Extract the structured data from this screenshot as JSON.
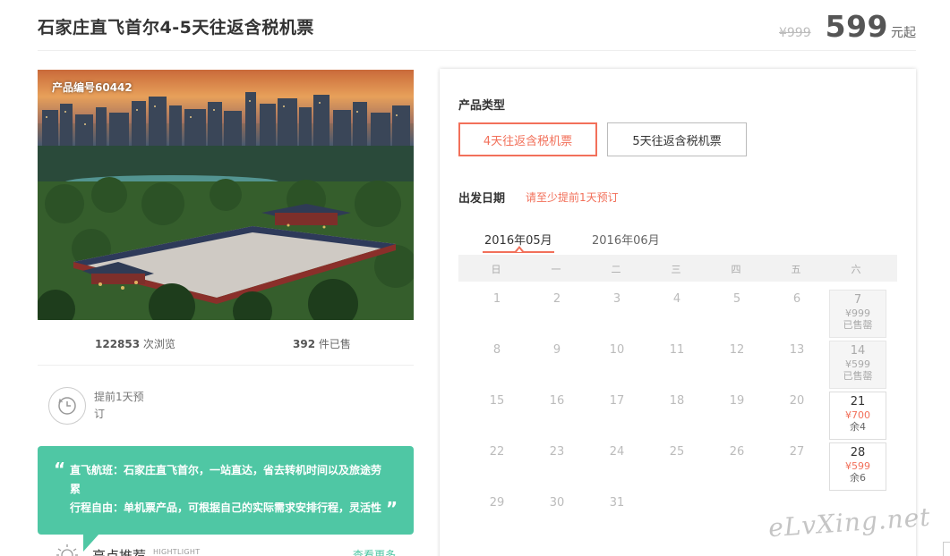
{
  "header": {
    "title": "石家庄直飞首尔4-5天往返含税机票",
    "old_price": "¥999",
    "price": "599",
    "price_unit": "元起"
  },
  "gallery": {
    "product_no": "产品编号60442"
  },
  "stats": {
    "views_num": "122853",
    "views_label": " 次浏览",
    "sold_num": "392",
    "sold_label": " 件已售"
  },
  "booking_tip": {
    "icon": "clock-icon",
    "text": "提前1天预订"
  },
  "features": {
    "line1": "直飞航班：石家庄直飞首尔，一站直达，省去转机时间以及旅途劳累",
    "line2": "行程自由：单机票产品，可根据自己的实际需求安排行程，灵活性",
    "quote_open": "“",
    "quote_close": "”"
  },
  "highlights": {
    "icon": "sun-icon",
    "title": "亮点推荐",
    "subtitle": "HIGHTLIGHT",
    "more_link": "查看更多"
  },
  "booking": {
    "type_label": "产品类型",
    "types": [
      {
        "label": "4天往返含税机票",
        "selected": true
      },
      {
        "label": "5天往返含税机票",
        "selected": false
      }
    ],
    "date_label": "出发日期",
    "date_hint": "请至少提前1天预订",
    "months": [
      "2016年05月",
      "2016年06月"
    ],
    "active_month": "2016年05月",
    "weekdays": [
      "日",
      "一",
      "二",
      "三",
      "四",
      "五",
      "六"
    ],
    "weeks": [
      [
        "1",
        "2",
        "3",
        "4",
        "5",
        "6",
        "7"
      ],
      [
        "8",
        "9",
        "10",
        "11",
        "12",
        "13",
        "14"
      ],
      [
        "15",
        "16",
        "17",
        "18",
        "19",
        "20",
        "21"
      ],
      [
        "22",
        "23",
        "24",
        "25",
        "26",
        "27",
        "28"
      ],
      [
        "29",
        "30",
        "31"
      ]
    ],
    "priced_days": [
      {
        "day": "7",
        "price": "¥999",
        "status": "已售罄",
        "available": false
      },
      {
        "day": "14",
        "price": "¥599",
        "status": "已售罄",
        "available": false
      },
      {
        "day": "21",
        "price": "¥700",
        "status": "余4",
        "available": true
      },
      {
        "day": "28",
        "price": "¥599",
        "status": "余6",
        "available": true
      }
    ]
  },
  "watermark": "eLvXing.net",
  "colors": {
    "accent": "#f2705a",
    "green": "#4fc7a4",
    "text": "#333333"
  }
}
